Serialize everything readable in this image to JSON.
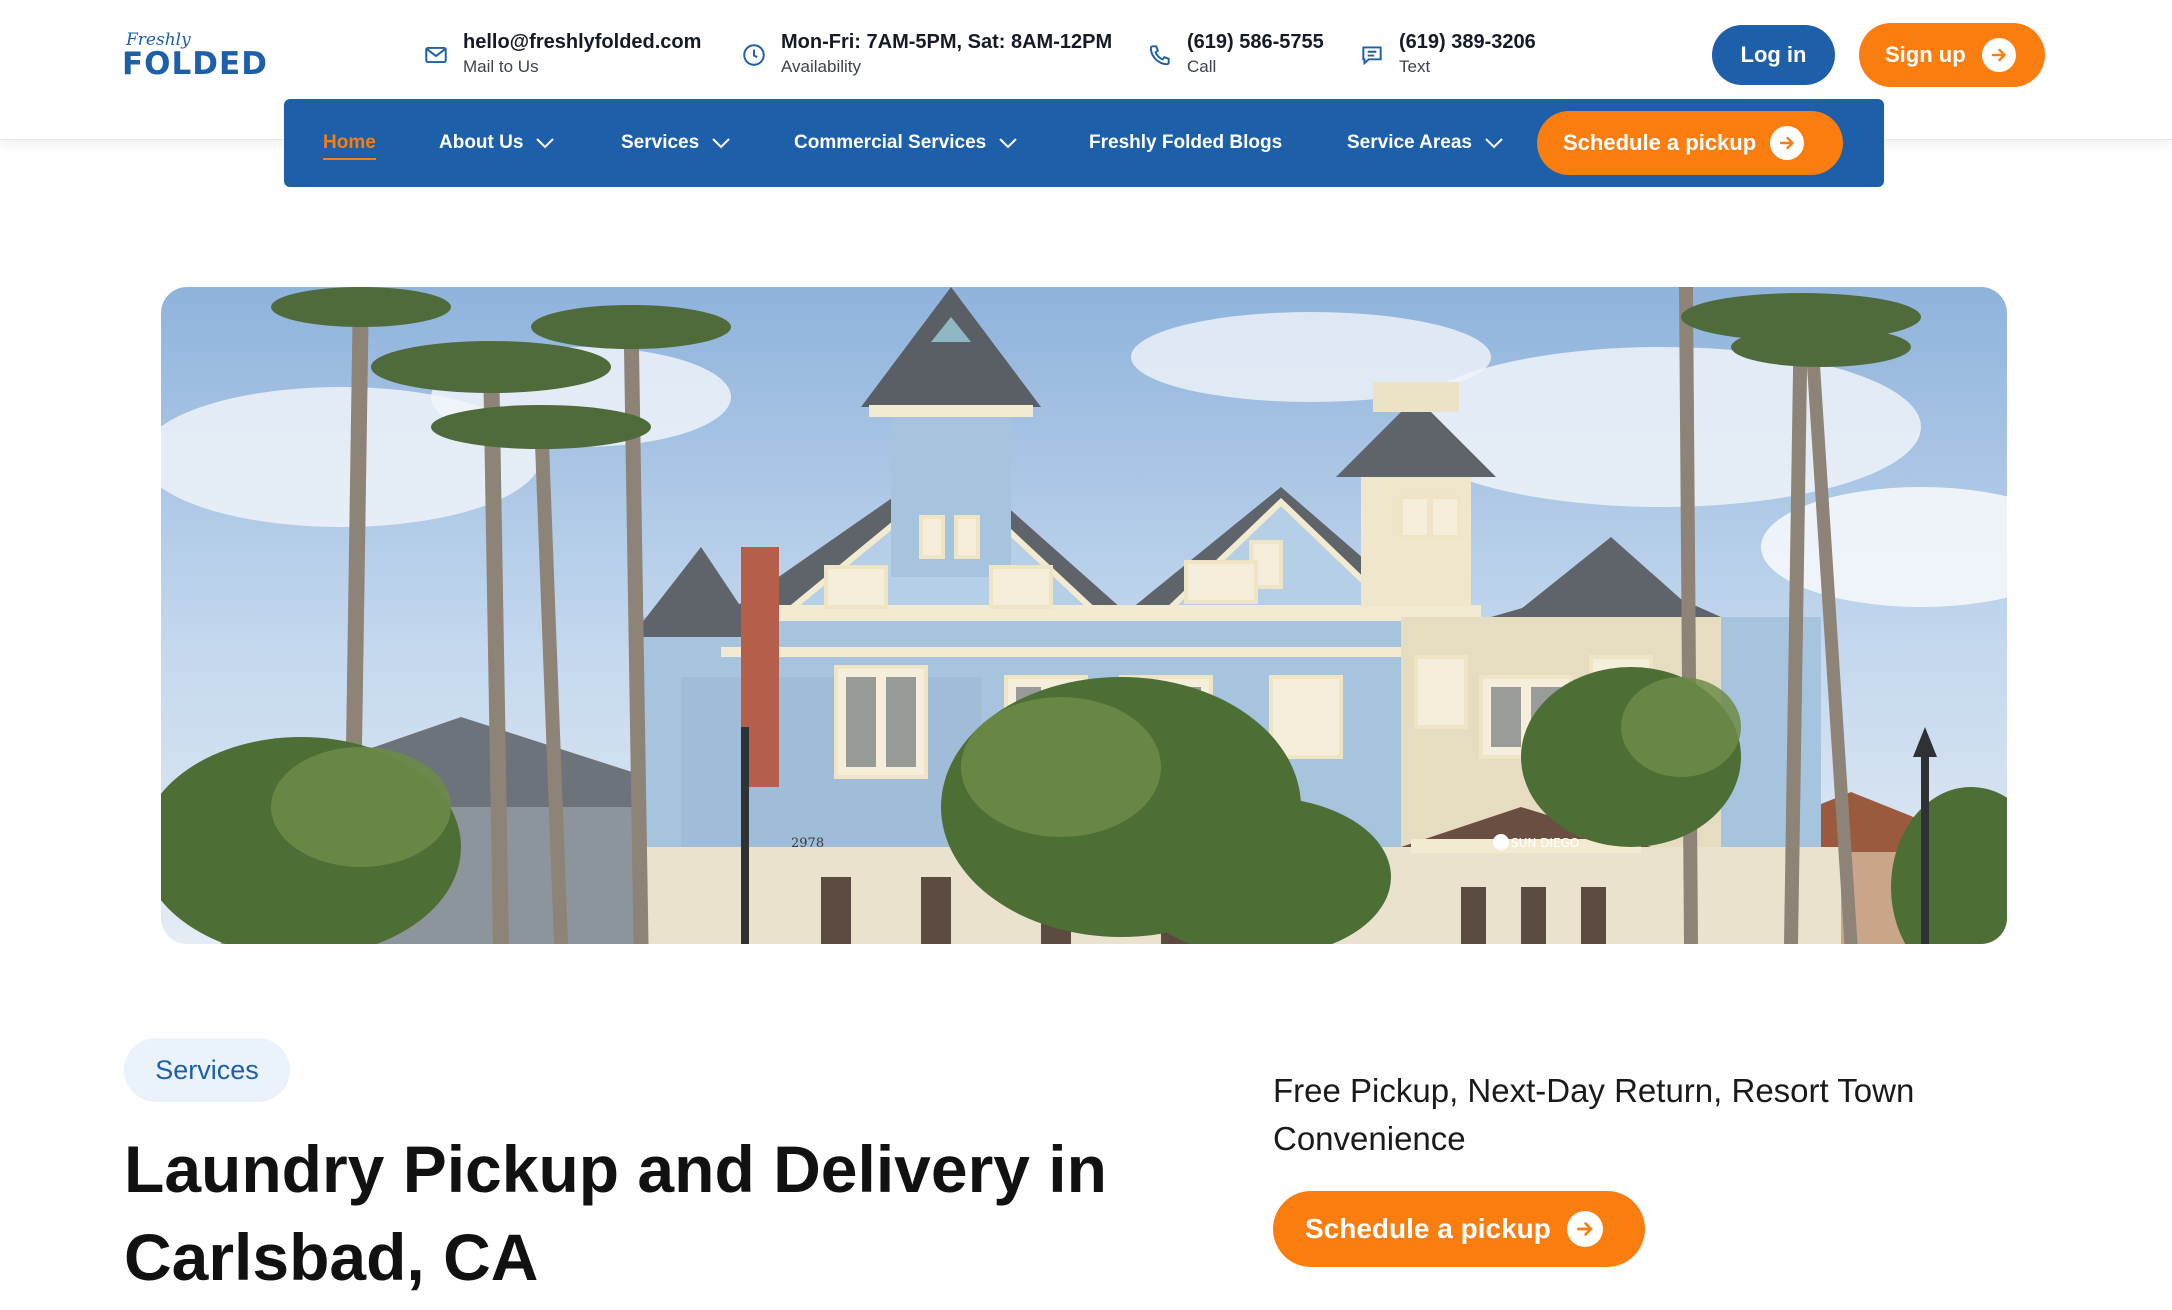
{
  "logo": {
    "script_text": "Freshly",
    "main_text": "FOLDED"
  },
  "contacts": [
    {
      "icon": "mail-icon",
      "main": "hello@freshlyfolded.com",
      "sub": "Mail to Us"
    },
    {
      "icon": "clock-icon",
      "main": "Mon-Fri: 7AM-5PM, Sat: 8AM-12PM",
      "sub": "Availability"
    },
    {
      "icon": "phone-icon",
      "main": "(619) 586-5755",
      "sub": "Call"
    },
    {
      "icon": "chat-icon",
      "main": "(619) 389-3206",
      "sub": "Text"
    }
  ],
  "auth": {
    "login_label": "Log in",
    "signup_label": "Sign up"
  },
  "nav": {
    "items": [
      {
        "label": "Home",
        "active": true,
        "dropdown": false
      },
      {
        "label": "About Us",
        "dropdown": true
      },
      {
        "label": "Services",
        "dropdown": true
      },
      {
        "label": "Commercial Services",
        "dropdown": true
      },
      {
        "label": "Freshly Folded Blogs",
        "dropdown": false
      },
      {
        "label": "Service Areas",
        "dropdown": true
      }
    ],
    "cta_label": "Schedule a pickup"
  },
  "hero": {
    "sign_text": "SUN DIEGO",
    "address_text": "2978"
  },
  "section": {
    "pill_label": "Services",
    "headline": "Laundry Pickup and Delivery in Carlsbad, CA",
    "tagline": "Free Pickup, Next-Day Return, Resort Town Convenience",
    "cta_label": "Schedule a pickup"
  },
  "colors": {
    "brand_blue": "#1d5fa8",
    "accent_orange": "#fa7d10",
    "pill_bg": "#eaf3fc"
  }
}
